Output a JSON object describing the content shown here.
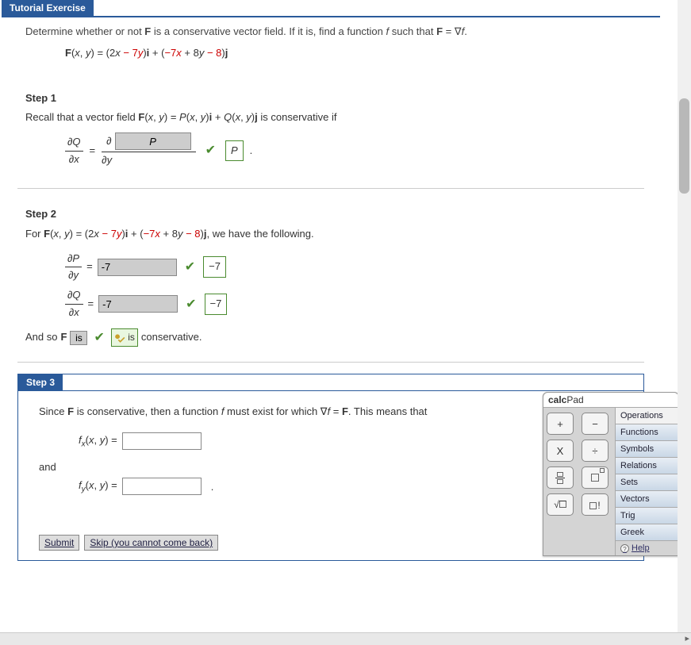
{
  "header": {
    "title": "Tutorial Exercise"
  },
  "problem": {
    "text": "Determine whether or not F is a conservative vector field. If it is, find a function f such that F = ∇f.",
    "equation_parts": {
      "lhs": "F(x, y) = (2x ",
      "m7y": "− 7y",
      "mid1": ")i + (",
      "m7x": "−7x",
      "p8y": " + 8y",
      "m8": " − 8",
      "end": ")j"
    }
  },
  "step1": {
    "label": "Step 1",
    "text_a": "Recall that a vector field ",
    "text_b": "F(x, y) = P(x, y)i + Q(x, y)j",
    "text_c": " is conservative if",
    "dQdx_num": "∂Q",
    "dQdx_den": "∂x",
    "eq": "=",
    "d_sym": "∂",
    "input_val": "P",
    "dy": "∂y",
    "ans_box": "P",
    "dot": "."
  },
  "step2": {
    "label": "Step 2",
    "pre": "For ",
    "post": ", we have the following.",
    "dPdy_num": "∂P",
    "dPdy_den": "∂y",
    "dQdx_num": "∂Q",
    "dQdx_den": "∂x",
    "val1": "-7",
    "ans1": "−7",
    "val2": "-7",
    "ans2": "−7",
    "andso_a": "And so ",
    "andso_F": "F",
    "is1": "is",
    "is2": "is",
    "cons": " conservative."
  },
  "step3": {
    "label": "Step 3",
    "line_a": "Since ",
    "line_b": "F",
    "line_c": " is conservative, then a function f must exist for which ∇f = ",
    "line_d": "F",
    "line_e": ". This means that",
    "fx": "f",
    "fx_sub": "x",
    "fx_args": "(x, y) =",
    "and": "and",
    "fy": "f",
    "fy_sub": "y",
    "fy_args": "(x, y) =",
    "dot": ".",
    "submit": "Submit",
    "skip": "Skip (you cannot come back)"
  },
  "calcpad": {
    "title_a": "calc",
    "title_b": "Pad",
    "cats": [
      "Operations",
      "Functions",
      "Symbols",
      "Relations",
      "Sets",
      "Vectors",
      "Trig",
      "Greek"
    ],
    "help": "Help",
    "btn_plus": "+",
    "btn_minus": "−",
    "btn_x": "X",
    "btn_div": "÷",
    "btn_frac": "▭",
    "btn_pow": "▭",
    "btn_sqrt": "√▭",
    "btn_fact": "▭!"
  }
}
